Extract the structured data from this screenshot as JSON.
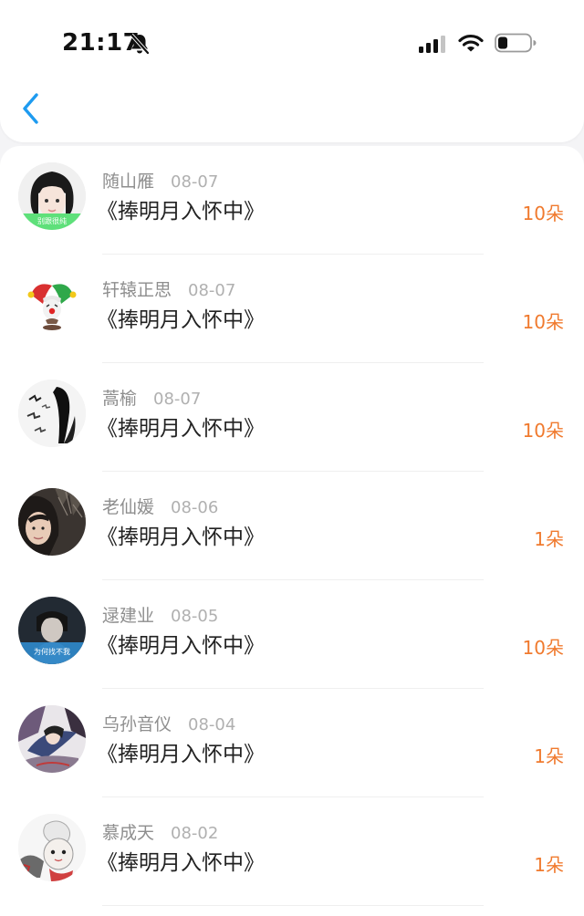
{
  "status_bar": {
    "time": "21:17"
  },
  "nav": {
    "back_icon": "chevron-left-icon",
    "accent_color": "#1e9bf0"
  },
  "colors": {
    "amount": "#f07a2e",
    "name": "#8e8e8e",
    "date": "#b0b0b0"
  },
  "items": [
    {
      "name": "随山雁",
      "date": "08-07",
      "title": "《捧明月入怀中》",
      "amount": "10朵",
      "avatar_caption": "别跟很纯"
    },
    {
      "name": "轩辕正思",
      "date": "08-07",
      "title": "《捧明月入怀中》",
      "amount": "10朵"
    },
    {
      "name": "蒿榆",
      "date": "08-07",
      "title": "《捧明月入怀中》",
      "amount": "10朵"
    },
    {
      "name": "老仙媛",
      "date": "08-06",
      "title": "《捧明月入怀中》",
      "amount": "1朵"
    },
    {
      "name": "逯建业",
      "date": "08-05",
      "title": "《捧明月入怀中》",
      "amount": "10朵",
      "avatar_caption": "为何找不我"
    },
    {
      "name": "乌孙音仪",
      "date": "08-04",
      "title": "《捧明月入怀中》",
      "amount": "1朵"
    },
    {
      "name": "慕成天",
      "date": "08-02",
      "title": "《捧明月入怀中》",
      "amount": "1朵"
    }
  ]
}
